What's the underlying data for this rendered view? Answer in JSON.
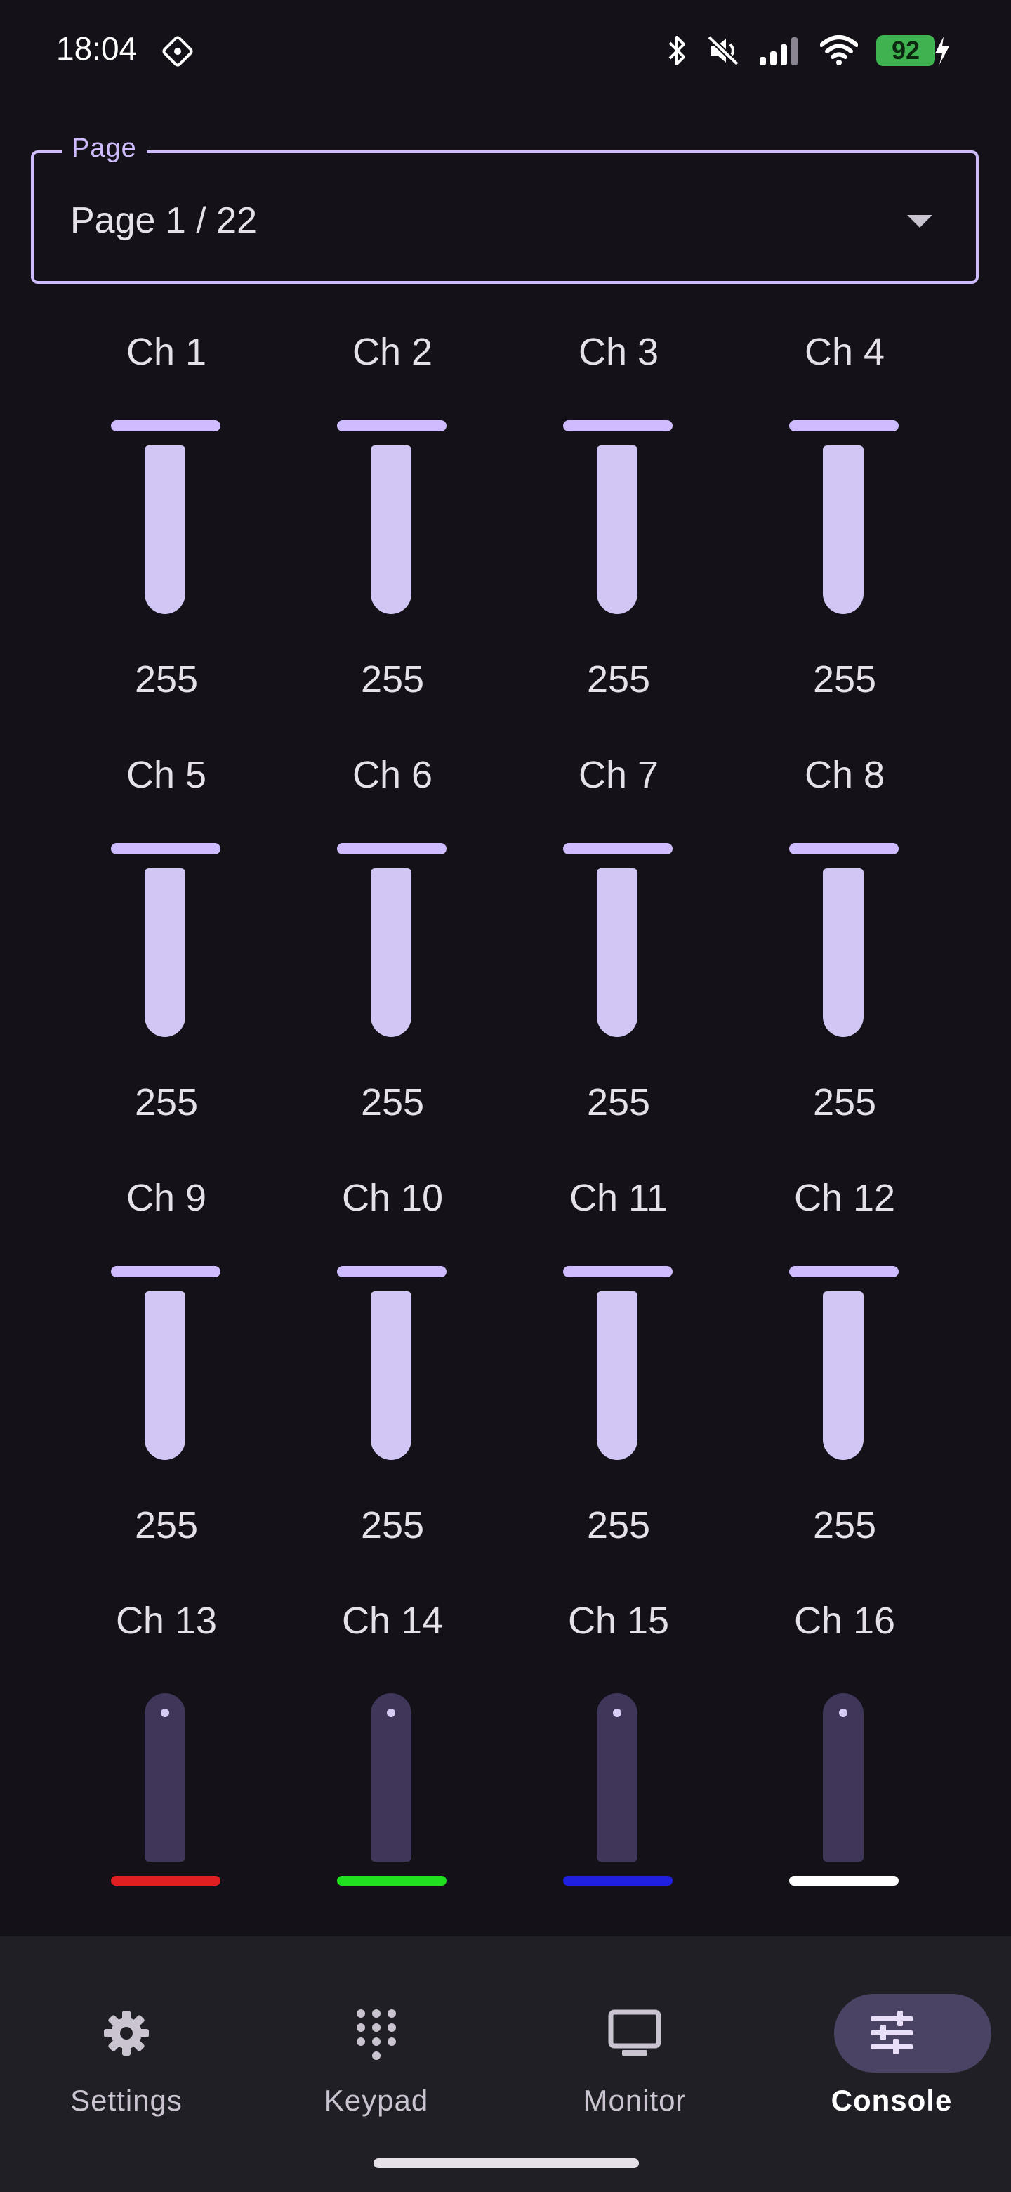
{
  "status_bar": {
    "time": "18:04",
    "battery": "92",
    "icons": [
      "bluetooth-icon",
      "mute-icon",
      "signal-icon",
      "wifi-icon",
      "battery-charging-icon"
    ]
  },
  "page_select": {
    "label": "Page",
    "value": "Page 1 / 22"
  },
  "channels": [
    {
      "label": "Ch 1",
      "value": "255"
    },
    {
      "label": "Ch 2",
      "value": "255"
    },
    {
      "label": "Ch 3",
      "value": "255"
    },
    {
      "label": "Ch 4",
      "value": "255"
    },
    {
      "label": "Ch 5",
      "value": "255"
    },
    {
      "label": "Ch 6",
      "value": "255"
    },
    {
      "label": "Ch 7",
      "value": "255"
    },
    {
      "label": "Ch 8",
      "value": "255"
    },
    {
      "label": "Ch 9",
      "value": "255"
    },
    {
      "label": "Ch 10",
      "value": "255"
    },
    {
      "label": "Ch 11",
      "value": "255"
    },
    {
      "label": "Ch 12",
      "value": "255"
    },
    {
      "label": "Ch 13",
      "color": "#e02020"
    },
    {
      "label": "Ch 14",
      "color": "#20e020"
    },
    {
      "label": "Ch 15",
      "color": "#2020e0"
    },
    {
      "label": "Ch 16",
      "color": "#ffffff"
    }
  ],
  "nav": {
    "items": [
      {
        "label": "Settings",
        "icon": "gear-icon"
      },
      {
        "label": "Keypad",
        "icon": "dialpad-icon"
      },
      {
        "label": "Monitor",
        "icon": "monitor-icon"
      },
      {
        "label": "Console",
        "icon": "sliders-icon",
        "active": true
      }
    ]
  },
  "colors": {
    "accent": "#cfbcff",
    "background": "#141218",
    "nav_background": "#211f26",
    "active_pill": "#4a4363"
  }
}
